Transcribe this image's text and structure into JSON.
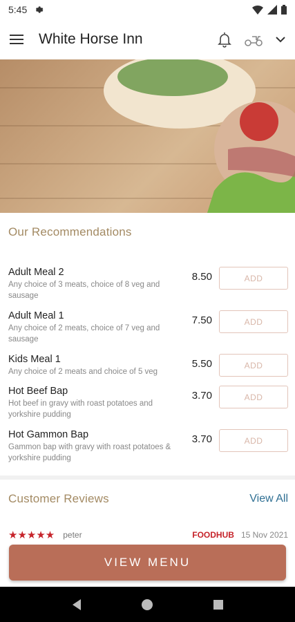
{
  "status": {
    "time": "5:45"
  },
  "header": {
    "title": "White Horse Inn"
  },
  "recommendations": {
    "title": "Our Recommendations",
    "items": [
      {
        "name": "Adult Meal 2",
        "desc": "Any choice of 3 meats, choice of 8 veg and sausage",
        "price": "8.50",
        "add": "ADD"
      },
      {
        "name": "Adult Meal 1",
        "desc": "Any choice of 2 meats, choice of 7 veg and sausage",
        "price": "7.50",
        "add": "ADD"
      },
      {
        "name": "Kids Meal 1",
        "desc": "Any choice of 2 meats and choice of 5 veg",
        "price": "5.50",
        "add": "ADD"
      },
      {
        "name": "Hot Beef Bap",
        "desc": "Hot beef in gravy with roast potatoes and yorkshire pudding",
        "price": "3.70",
        "add": "ADD"
      },
      {
        "name": "Hot Gammon Bap",
        "desc": "Gammon bap with gravy with roast potatoes & yorkshire pudding",
        "price": "3.70",
        "add": "ADD"
      }
    ]
  },
  "reviews": {
    "title": "Customer Reviews",
    "view_all": "View All",
    "first": {
      "stars": "★★★★★",
      "reviewer": "peter",
      "source": "FOODHUB",
      "date": "15 Nov 2021"
    }
  },
  "cta": {
    "label": "VIEW MENU"
  },
  "colors": {
    "accent": "#b96e58",
    "heading": "#a38a63",
    "link": "#2f6f93",
    "stars": "#c6232a"
  }
}
